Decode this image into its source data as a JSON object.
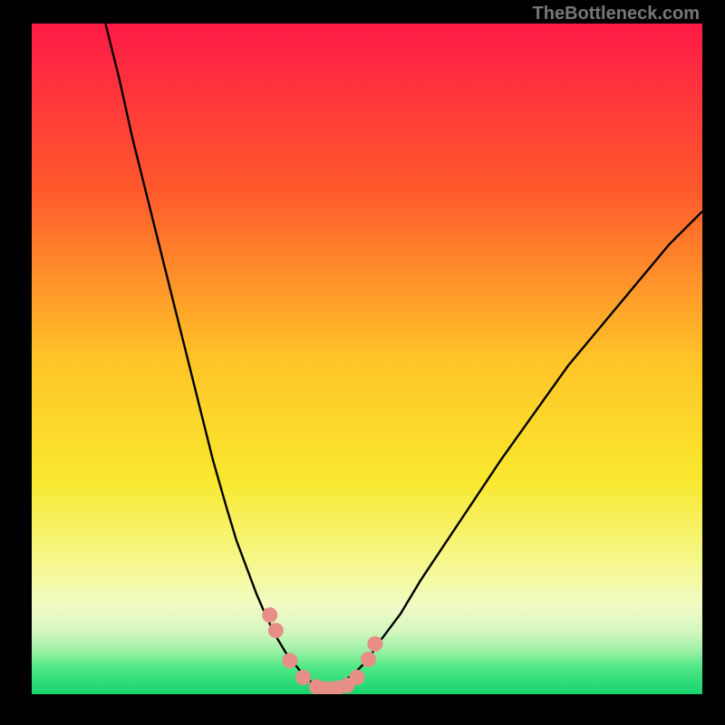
{
  "watermark": {
    "text": "TheBottleneck.com"
  },
  "colors": {
    "frame": "#000000",
    "curve": "#000000",
    "marker": "#e78f87",
    "wm": "#777777",
    "gradient_stops": [
      {
        "offset": 0.0,
        "color": "#ff1a47"
      },
      {
        "offset": 0.25,
        "color": "#ff5a2c"
      },
      {
        "offset": 0.5,
        "color": "#ffc428"
      },
      {
        "offset": 0.68,
        "color": "#f9e82e"
      },
      {
        "offset": 0.8,
        "color": "#f6f88a"
      },
      {
        "offset": 0.87,
        "color": "#f1fac7"
      },
      {
        "offset": 0.905,
        "color": "#d6f7c0"
      },
      {
        "offset": 0.935,
        "color": "#9df0a5"
      },
      {
        "offset": 0.96,
        "color": "#4fe886"
      },
      {
        "offset": 1.0,
        "color": "#17d26b"
      }
    ]
  },
  "chart_data": {
    "type": "line",
    "title": "",
    "xlabel": "",
    "ylabel": "",
    "xlim": [
      0,
      100
    ],
    "ylim": [
      0,
      100
    ],
    "series": [
      {
        "name": "left-curve",
        "x": [
          11,
          13,
          15,
          17,
          19,
          21,
          23,
          25,
          27,
          29,
          30.5,
          32,
          33.5,
          35,
          36.5,
          38,
          40,
          42,
          44.5
        ],
        "y": [
          100,
          92,
          83,
          75,
          67,
          59,
          51,
          43,
          35,
          28,
          23,
          19,
          15,
          11.5,
          8.5,
          6,
          3.5,
          1.5,
          0.8
        ]
      },
      {
        "name": "right-curve",
        "x": [
          44.5,
          46,
          48,
          50,
          52,
          55,
          58,
          62,
          66,
          70,
          75,
          80,
          85,
          90,
          95,
          100
        ],
        "y": [
          0.8,
          1.5,
          3,
          5,
          8,
          12,
          17,
          23,
          29,
          35,
          42,
          49,
          55,
          61,
          67,
          72
        ]
      }
    ],
    "markers": {
      "name": "highlight-dots",
      "x": [
        35.5,
        36.4,
        38.5,
        40.5,
        42.5,
        44.0,
        45.5,
        47.0,
        48.5,
        50.2,
        51.2
      ],
      "y": [
        11.8,
        9.5,
        5.0,
        2.5,
        1.1,
        0.8,
        0.9,
        1.3,
        2.5,
        5.2,
        7.5
      ]
    }
  }
}
